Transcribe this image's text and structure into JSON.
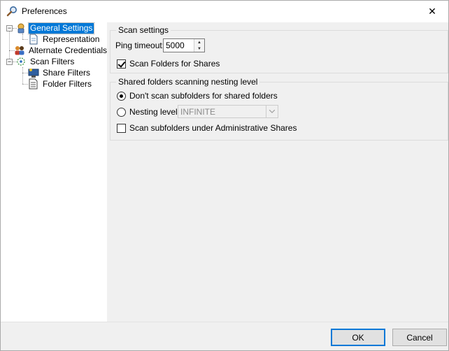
{
  "window": {
    "title": "Preferences",
    "close_glyph": "✕"
  },
  "tree": {
    "items": [
      {
        "label": "General Settings",
        "icon": "general-settings-icon",
        "selected": true
      },
      {
        "label": "Representation",
        "icon": "document-icon"
      },
      {
        "label": "Alternate Credentials",
        "icon": "users-icon"
      },
      {
        "label": "Scan Filters",
        "icon": "scan-filters-icon"
      },
      {
        "label": "Share Filters",
        "icon": "share-filters-icon"
      },
      {
        "label": "Folder Filters",
        "icon": "folder-filters-icon"
      }
    ],
    "expander_glyph": "−"
  },
  "scan_settings": {
    "legend": "Scan settings",
    "ping_timeout_label": "Ping timeout:",
    "ping_timeout_value": "5000",
    "scan_folders_label": "Scan Folders for Shares",
    "scan_folders_checked": true
  },
  "nesting": {
    "legend": "Shared folders scanning nesting level",
    "dont_scan_label": "Don't scan subfolders for shared folders",
    "dont_scan_selected": true,
    "nesting_level_label": "Nesting level:",
    "nesting_level_value": "INFINITE",
    "admin_shares_label": "Scan subfolders under Administrative Shares",
    "admin_shares_checked": false
  },
  "footer": {
    "ok_label": "OK",
    "cancel_label": "Cancel"
  },
  "colors": {
    "selection": "#0078d7",
    "panel": "#f0f0f0"
  }
}
